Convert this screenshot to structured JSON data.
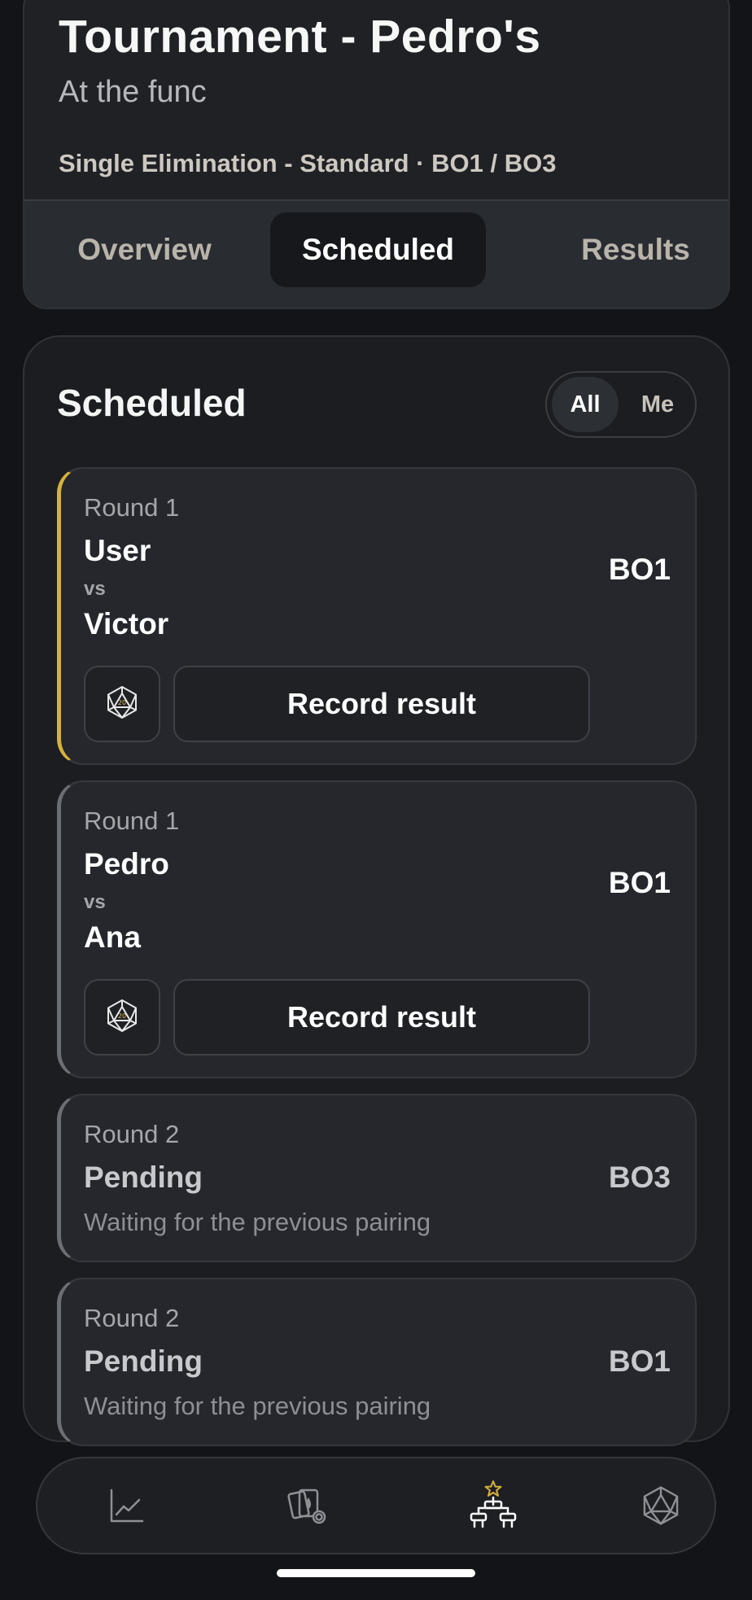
{
  "header": {
    "title": "Tournament - Pedro's",
    "subtitle": "At the func",
    "format": "Single Elimination - Standard · BO1 / BO3"
  },
  "tabs": [
    {
      "label": "Overview",
      "active": false
    },
    {
      "label": "Scheduled",
      "active": true
    },
    {
      "label": "Results",
      "active": false
    }
  ],
  "scheduled": {
    "title": "Scheduled",
    "filter": {
      "all": "All",
      "me": "Me",
      "selected": "All"
    },
    "matches": [
      {
        "round": "Round 1",
        "player1": "User",
        "vs": "vs",
        "player2": "Victor",
        "bo": "BO1",
        "action": "Record result"
      },
      {
        "round": "Round 1",
        "player1": "Pedro",
        "vs": "vs",
        "player2": "Ana",
        "bo": "BO1",
        "action": "Record result"
      },
      {
        "round": "Round 2",
        "status": "Pending",
        "note": "Waiting for the previous pairing",
        "bo": "BO3"
      },
      {
        "round": "Round 2",
        "status": "Pending",
        "note": "Waiting for the previous pairing",
        "bo": "BO1"
      }
    ]
  },
  "nav": {
    "items": [
      {
        "icon": "chart-line-icon",
        "active": false
      },
      {
        "icon": "cards-settings-icon",
        "active": false
      },
      {
        "icon": "bracket-star-icon",
        "active": true
      },
      {
        "icon": "d20-dice-icon",
        "active": false
      }
    ]
  },
  "colors": {
    "accent": "#d6b23c",
    "background": "#131417",
    "card": "#25272c"
  }
}
